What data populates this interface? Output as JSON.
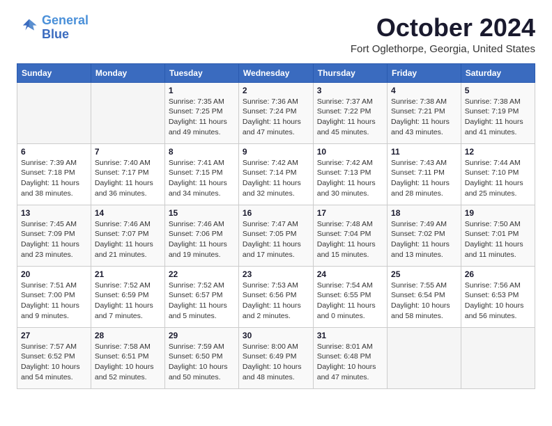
{
  "logo": {
    "line1": "General",
    "line2": "Blue"
  },
  "title": {
    "month": "October 2024",
    "location": "Fort Oglethorpe, Georgia, United States"
  },
  "weekdays": [
    "Sunday",
    "Monday",
    "Tuesday",
    "Wednesday",
    "Thursday",
    "Friday",
    "Saturday"
  ],
  "weeks": [
    [
      {
        "day": "",
        "info": ""
      },
      {
        "day": "",
        "info": ""
      },
      {
        "day": "1",
        "info": "Sunrise: 7:35 AM\nSunset: 7:25 PM\nDaylight: 11 hours and 49 minutes."
      },
      {
        "day": "2",
        "info": "Sunrise: 7:36 AM\nSunset: 7:24 PM\nDaylight: 11 hours and 47 minutes."
      },
      {
        "day": "3",
        "info": "Sunrise: 7:37 AM\nSunset: 7:22 PM\nDaylight: 11 hours and 45 minutes."
      },
      {
        "day": "4",
        "info": "Sunrise: 7:38 AM\nSunset: 7:21 PM\nDaylight: 11 hours and 43 minutes."
      },
      {
        "day": "5",
        "info": "Sunrise: 7:38 AM\nSunset: 7:19 PM\nDaylight: 11 hours and 41 minutes."
      }
    ],
    [
      {
        "day": "6",
        "info": "Sunrise: 7:39 AM\nSunset: 7:18 PM\nDaylight: 11 hours and 38 minutes."
      },
      {
        "day": "7",
        "info": "Sunrise: 7:40 AM\nSunset: 7:17 PM\nDaylight: 11 hours and 36 minutes."
      },
      {
        "day": "8",
        "info": "Sunrise: 7:41 AM\nSunset: 7:15 PM\nDaylight: 11 hours and 34 minutes."
      },
      {
        "day": "9",
        "info": "Sunrise: 7:42 AM\nSunset: 7:14 PM\nDaylight: 11 hours and 32 minutes."
      },
      {
        "day": "10",
        "info": "Sunrise: 7:42 AM\nSunset: 7:13 PM\nDaylight: 11 hours and 30 minutes."
      },
      {
        "day": "11",
        "info": "Sunrise: 7:43 AM\nSunset: 7:11 PM\nDaylight: 11 hours and 28 minutes."
      },
      {
        "day": "12",
        "info": "Sunrise: 7:44 AM\nSunset: 7:10 PM\nDaylight: 11 hours and 25 minutes."
      }
    ],
    [
      {
        "day": "13",
        "info": "Sunrise: 7:45 AM\nSunset: 7:09 PM\nDaylight: 11 hours and 23 minutes."
      },
      {
        "day": "14",
        "info": "Sunrise: 7:46 AM\nSunset: 7:07 PM\nDaylight: 11 hours and 21 minutes."
      },
      {
        "day": "15",
        "info": "Sunrise: 7:46 AM\nSunset: 7:06 PM\nDaylight: 11 hours and 19 minutes."
      },
      {
        "day": "16",
        "info": "Sunrise: 7:47 AM\nSunset: 7:05 PM\nDaylight: 11 hours and 17 minutes."
      },
      {
        "day": "17",
        "info": "Sunrise: 7:48 AM\nSunset: 7:04 PM\nDaylight: 11 hours and 15 minutes."
      },
      {
        "day": "18",
        "info": "Sunrise: 7:49 AM\nSunset: 7:02 PM\nDaylight: 11 hours and 13 minutes."
      },
      {
        "day": "19",
        "info": "Sunrise: 7:50 AM\nSunset: 7:01 PM\nDaylight: 11 hours and 11 minutes."
      }
    ],
    [
      {
        "day": "20",
        "info": "Sunrise: 7:51 AM\nSunset: 7:00 PM\nDaylight: 11 hours and 9 minutes."
      },
      {
        "day": "21",
        "info": "Sunrise: 7:52 AM\nSunset: 6:59 PM\nDaylight: 11 hours and 7 minutes."
      },
      {
        "day": "22",
        "info": "Sunrise: 7:52 AM\nSunset: 6:57 PM\nDaylight: 11 hours and 5 minutes."
      },
      {
        "day": "23",
        "info": "Sunrise: 7:53 AM\nSunset: 6:56 PM\nDaylight: 11 hours and 2 minutes."
      },
      {
        "day": "24",
        "info": "Sunrise: 7:54 AM\nSunset: 6:55 PM\nDaylight: 11 hours and 0 minutes."
      },
      {
        "day": "25",
        "info": "Sunrise: 7:55 AM\nSunset: 6:54 PM\nDaylight: 10 hours and 58 minutes."
      },
      {
        "day": "26",
        "info": "Sunrise: 7:56 AM\nSunset: 6:53 PM\nDaylight: 10 hours and 56 minutes."
      }
    ],
    [
      {
        "day": "27",
        "info": "Sunrise: 7:57 AM\nSunset: 6:52 PM\nDaylight: 10 hours and 54 minutes."
      },
      {
        "day": "28",
        "info": "Sunrise: 7:58 AM\nSunset: 6:51 PM\nDaylight: 10 hours and 52 minutes."
      },
      {
        "day": "29",
        "info": "Sunrise: 7:59 AM\nSunset: 6:50 PM\nDaylight: 10 hours and 50 minutes."
      },
      {
        "day": "30",
        "info": "Sunrise: 8:00 AM\nSunset: 6:49 PM\nDaylight: 10 hours and 48 minutes."
      },
      {
        "day": "31",
        "info": "Sunrise: 8:01 AM\nSunset: 6:48 PM\nDaylight: 10 hours and 47 minutes."
      },
      {
        "day": "",
        "info": ""
      },
      {
        "day": "",
        "info": ""
      }
    ]
  ]
}
